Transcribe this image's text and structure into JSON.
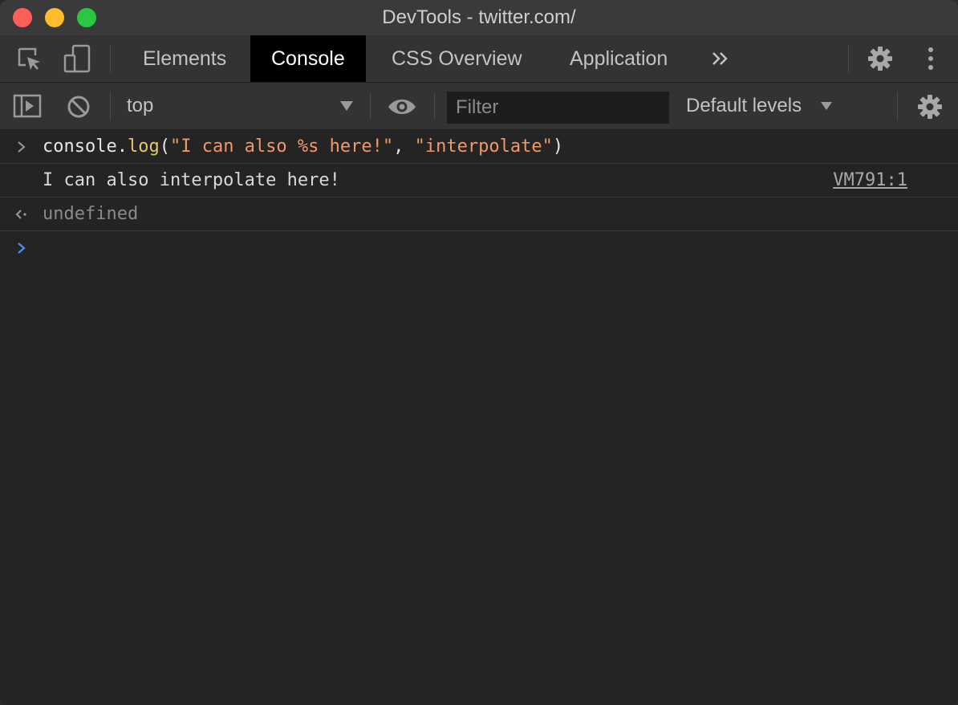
{
  "window": {
    "title": "DevTools - twitter.com/"
  },
  "tabs": [
    {
      "label": "Elements",
      "active": false
    },
    {
      "label": "Console",
      "active": true
    },
    {
      "label": "CSS Overview",
      "active": false
    },
    {
      "label": "Application",
      "active": false
    }
  ],
  "tabbar_icons": [
    "inspect-element-icon",
    "device-toolbar-icon",
    "more-tabs-chevron-icon",
    "settings-gear-icon",
    "kebab-menu-icon"
  ],
  "toolbar": {
    "context": "top",
    "filter_placeholder": "Filter",
    "levels": "Default levels"
  },
  "console": {
    "input": {
      "object": "console",
      "dot": ".",
      "method": "log",
      "open": "(",
      "arg1": "\"I can also %s here!\"",
      "comma": ", ",
      "arg2": "\"interpolate\"",
      "close": ")"
    },
    "output": {
      "text": "I can also interpolate here!",
      "source": "VM791:1"
    },
    "result": "undefined"
  },
  "colors": {
    "string": "#f29766",
    "function": "#e8c56b",
    "prompt": "#4d8ef7",
    "active_tab_bg": "#000000"
  }
}
